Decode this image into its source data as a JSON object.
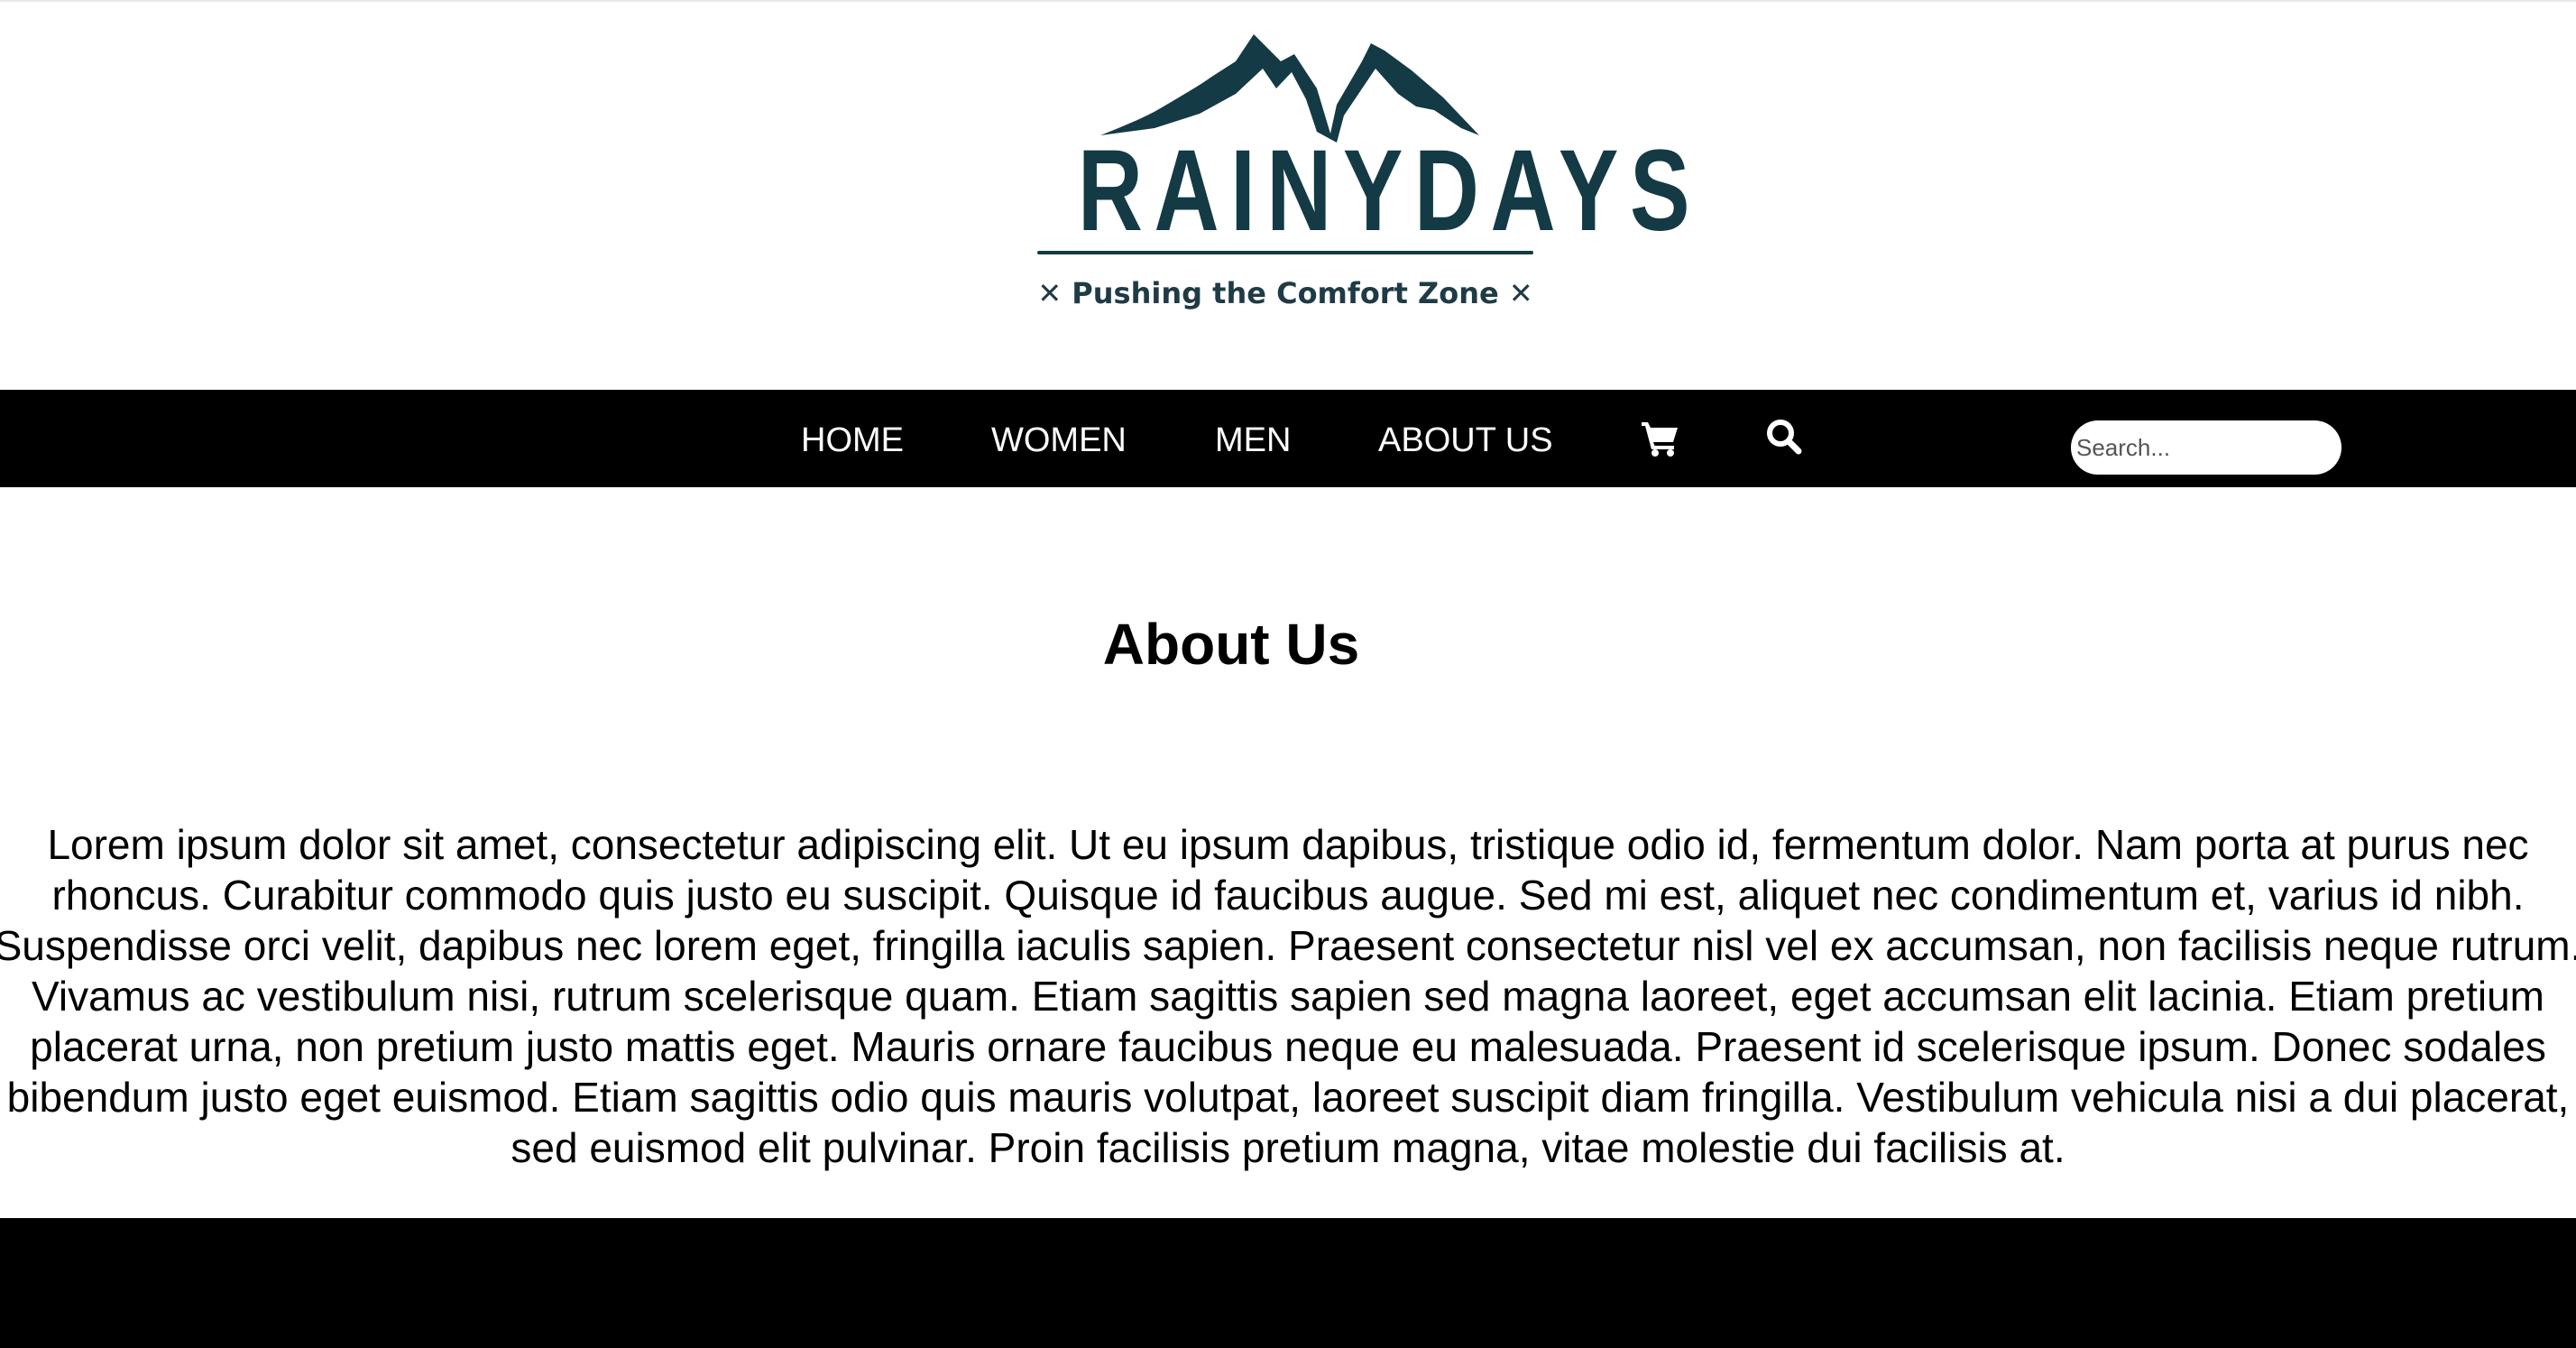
{
  "logo": {
    "brand": "RAINYDAYS",
    "tagline": "✕ Pushing the Comfort Zone ✕",
    "color": "#133a45"
  },
  "nav": {
    "items": [
      {
        "label": "HOME"
      },
      {
        "label": "WOMEN"
      },
      {
        "label": "MEN"
      },
      {
        "label": "ABOUT US"
      }
    ],
    "cart_icon": "cart-icon",
    "search_icon": "search-icon",
    "search_placeholder": "Search..."
  },
  "main": {
    "title": "About Us",
    "paragraph": "Lorem ipsum dolor sit amet, consectetur adipiscing elit. Ut eu ipsum dapibus, tristique odio id, fermentum dolor. Nam porta at purus nec rhoncus. Curabitur commodo quis justo eu suscipit. Quisque id faucibus augue. Sed mi est, aliquet nec condimentum et, varius id nibh. Suspendisse orci velit, dapibus nec lorem eget, fringilla iaculis sapien. Praesent consectetur nisl vel ex accumsan, non facilisis neque rutrum. Vivamus ac vestibulum nisi, rutrum scelerisque quam. Etiam sagittis sapien sed magna laoreet, eget accumsan elit lacinia. Etiam pretium placerat urna, non pretium justo mattis eget. Mauris ornare faucibus neque eu malesuada. Praesent id scelerisque ipsum. Donec sodales bibendum justo eget euismod. Etiam sagittis odio quis mauris volutpat, laoreet suscipit diam fringilla. Vestibulum vehicula nisi a dui placerat, sed euismod elit pulvinar. Proin facilisis pretium magna, vitae molestie dui facilisis at."
  },
  "colors": {
    "nav_bg": "#000000",
    "footer_bg": "#000000",
    "text": "#000000"
  }
}
